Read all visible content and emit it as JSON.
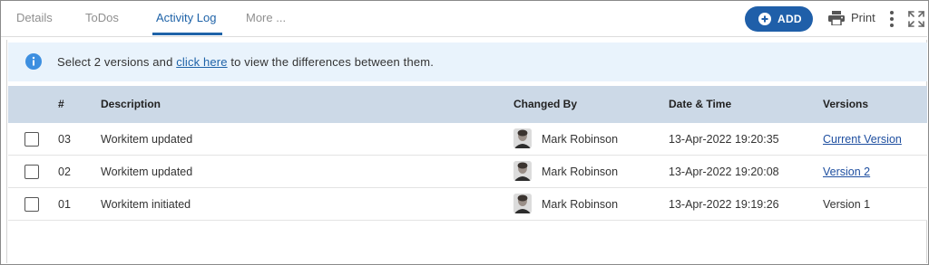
{
  "tabs": [
    {
      "label": "Details",
      "active": false
    },
    {
      "label": "ToDos",
      "active": false
    },
    {
      "label": "Activity Log",
      "active": true
    },
    {
      "label": "More ..."
    }
  ],
  "toolbar": {
    "add_label": "ADD",
    "print_label": "Print"
  },
  "info": {
    "text_before": "Select 2 versions and ",
    "link_text": "click here",
    "text_after": " to view the differences between them."
  },
  "table": {
    "headers": {
      "number": "#",
      "description": "Description",
      "changed_by": "Changed By",
      "date_time": "Date & Time",
      "versions": "Versions"
    },
    "rows": [
      {
        "number": "03",
        "description": "Workitem updated",
        "changed_by": "Mark Robinson",
        "date_time": "13-Apr-2022 19:20:35",
        "version": "Current Version",
        "version_is_link": true
      },
      {
        "number": "02",
        "description": "Workitem updated",
        "changed_by": "Mark Robinson",
        "date_time": "13-Apr-2022 19:20:08",
        "version": "Version 2",
        "version_is_link": true
      },
      {
        "number": "01",
        "description": "Workitem initiated",
        "changed_by": "Mark Robinson",
        "date_time": "13-Apr-2022 19:19:26",
        "version": "Version 1",
        "version_is_link": false
      }
    ]
  },
  "colors": {
    "accent": "#1f63a8",
    "add_button": "#1f5fa9",
    "info_background": "#e9f3fc",
    "header_background": "#ccd9e7"
  },
  "icons": {
    "add": "plus-circle-icon",
    "print": "printer-icon",
    "more": "kebab-menu-icon",
    "expand": "expand-icon",
    "info": "info-circle-icon",
    "avatar": "user-avatar"
  }
}
